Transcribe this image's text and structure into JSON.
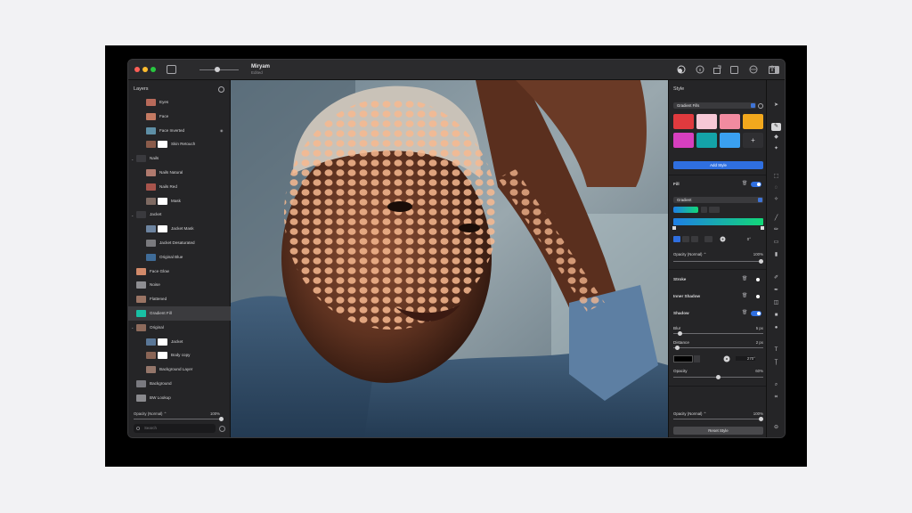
{
  "window": {
    "document_title": "Miryam",
    "document_status": "Edited"
  },
  "layers_panel": {
    "title": "Layers",
    "items": [
      {
        "label": "Eyes",
        "indent": 1,
        "thumb": "#b86a5a"
      },
      {
        "label": "Face",
        "indent": 1,
        "thumb": "#c47a62"
      },
      {
        "label": "Face Inverted",
        "indent": 1,
        "thumb": "#5e8fa6",
        "visible_icon": true
      },
      {
        "label": "Skin Retouch",
        "indent": 1,
        "thumb": "#8a5b4a",
        "mask": true
      },
      {
        "label": "Nails",
        "indent": 0,
        "group": true,
        "thumb": "#3a3a3e"
      },
      {
        "label": "Nails Natural",
        "indent": 1,
        "thumb": "#b07a6e"
      },
      {
        "label": "Nails Red",
        "indent": 1,
        "thumb": "#a8544c"
      },
      {
        "label": "Mask",
        "indent": 1,
        "thumb": "#7e6a62",
        "mask": true
      },
      {
        "label": "Jacket",
        "indent": 0,
        "group": true,
        "thumb": "#3a3a3e"
      },
      {
        "label": "Jacket Mask",
        "indent": 1,
        "thumb": "#6d84a0",
        "mask": true
      },
      {
        "label": "Jacket Desaturated",
        "indent": 1,
        "thumb": "#7a7a7e"
      },
      {
        "label": "Original Blue",
        "indent": 1,
        "thumb": "#3f6c98"
      },
      {
        "label": "Face Glow",
        "indent": 0,
        "thumb": "#d28a6a"
      },
      {
        "label": "Noise",
        "indent": 0,
        "thumb": "#8e8e92"
      },
      {
        "label": "Flattened",
        "indent": 0,
        "thumb": "#9a7464"
      },
      {
        "label": "Gradient Fill",
        "indent": 0,
        "thumb": "#18c0a4",
        "selected": true
      },
      {
        "label": "Original",
        "indent": 0,
        "group": true,
        "thumb": "#8d6b5c"
      },
      {
        "label": "Jacket",
        "indent": 1,
        "thumb": "#5a7797",
        "mask": true
      },
      {
        "label": "Body copy",
        "indent": 1,
        "thumb": "#8a6556",
        "mask": true
      },
      {
        "label": "Background Layer",
        "indent": 1,
        "thumb": "#94766a"
      },
      {
        "label": "Background",
        "indent": 0,
        "thumb": "#7a7a80"
      },
      {
        "label": "BW Lookup",
        "indent": 0,
        "thumb": "#8a8a8e"
      }
    ],
    "opacity_label": "Opacity (Normal) ⌃",
    "opacity_value": "100%",
    "opacity_level": 1.0,
    "search_placeholder": "Search"
  },
  "style_panel": {
    "title": "Style",
    "preset_select": "Gradient Fills",
    "swatches": [
      "#e03a3e",
      "#f7c8d6",
      "#f28ba0",
      "#f2a81d",
      "#d63fbf",
      "#14a3a8",
      "#3aa0f0"
    ],
    "add_style_label": "Add Style",
    "fill_label": "Fill",
    "fill_enabled": true,
    "fill_type_select": "Gradient",
    "gradient_colors": [
      "#1e7fe6",
      "#12d878"
    ],
    "fill_opacity_label": "Opacity (Normal) ⌃",
    "fill_opacity_value": "100%",
    "fill_angle": "0°",
    "stroke_label": "Stroke",
    "stroke_enabled": false,
    "inner_shadow_label": "Inner Shadow",
    "inner_shadow_enabled": false,
    "shadow_label": "Shadow",
    "shadow_enabled": true,
    "blur_label": "Blur",
    "blur_value": "5 px",
    "distance_label": "Distance",
    "distance_value": "2 px",
    "shadow_angle": "270°",
    "shadow_opacity_label": "Opacity",
    "shadow_opacity_value": "60%",
    "layer_opacity_label": "Opacity (Normal) ⌃",
    "layer_opacity_value": "100%",
    "reset_label": "Reset Style"
  },
  "colors": {
    "accent": "#2f6fe0",
    "panel": "#252527",
    "window": "#1e1e1f"
  }
}
